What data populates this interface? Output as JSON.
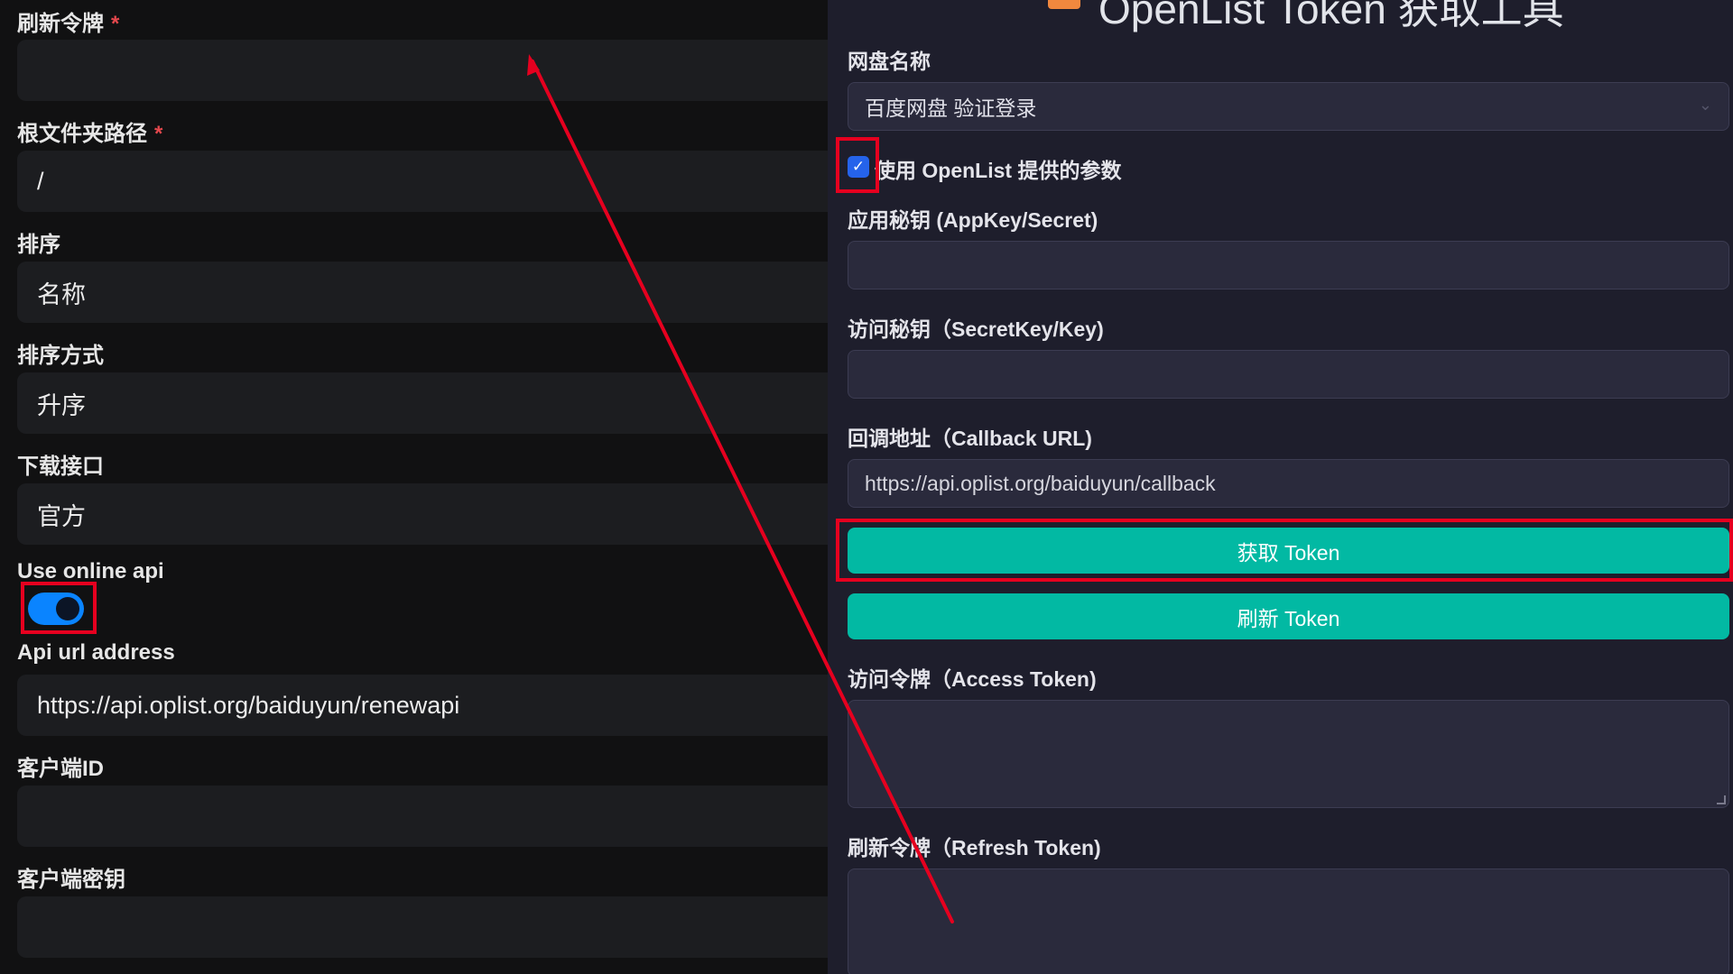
{
  "left_form": {
    "refresh_token_label": "刷新令牌",
    "required_mark": "*",
    "root_folder_label": "根文件夹路径",
    "root_folder_value": "/",
    "order_by_label": "排序",
    "order_by_value": "名称",
    "order_direction_label": "排序方式",
    "order_direction_value": "升序",
    "download_api_label": "下载接口",
    "download_api_value": "官方",
    "use_online_api_label": "Use online api",
    "use_online_api_enabled": true,
    "api_url_label": "Api url address",
    "api_url_value": "https://api.oplist.org/baiduyun/renewapi",
    "client_id_label": "客户端ID",
    "client_secret_label": "客户端密钥"
  },
  "token_tool": {
    "title": "OpenList Token 获取工具",
    "cloud_label": "网盘名称",
    "cloud_selected": "百度网盘 验证登录",
    "use_params_checked": true,
    "use_params_label": "使用 OpenList 提供的参数",
    "app_key_label": "应用秘钥 (AppKey/Secret)",
    "secret_key_label": "访问秘钥（SecretKey/Key)",
    "callback_label": "回调地址（Callback URL)",
    "callback_value": "https://api.oplist.org/baiduyun/callback",
    "get_token_button": "获取 Token",
    "refresh_token_button": "刷新 Token",
    "access_token_label": "访问令牌（Access Token)",
    "refresh_token_label": "刷新令牌（Refresh Token)"
  },
  "colors": {
    "accent_teal": "#02b9a3",
    "toggle_blue": "#0a84ff",
    "annotation_red": "#e6001f"
  }
}
